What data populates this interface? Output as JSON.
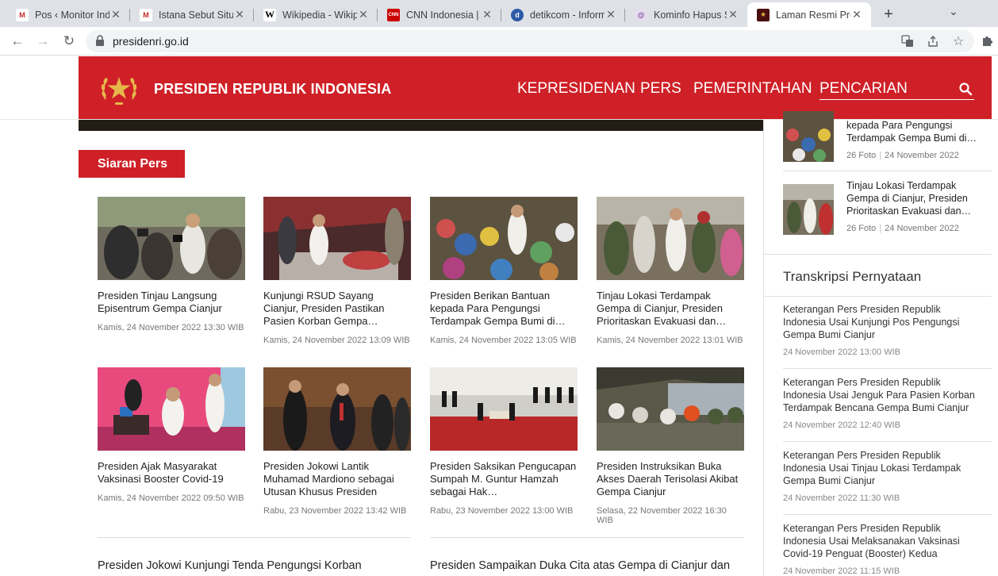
{
  "browser": {
    "tabs": [
      {
        "title": "Pos ‹ Monitor Ind",
        "favicon": "monitor-m-icon",
        "favicon_text": "M",
        "favicon_color": "#c62828"
      },
      {
        "title": "Istana Sebut Situs",
        "favicon": "monitor-m-icon",
        "favicon_text": "M",
        "favicon_color": "#c62828"
      },
      {
        "title": "Wikipedia - Wikip",
        "favicon": "wikipedia-w-icon",
        "favicon_text": "W",
        "favicon_color": "#000000"
      },
      {
        "title": "CNN Indonesia |",
        "favicon": "cnn-icon",
        "favicon_text": "CNN",
        "favicon_color": "#cc0000"
      },
      {
        "title": "detikcom - Inform",
        "favicon": "detik-icon",
        "favicon_text": "d",
        "favicon_color": "#2b5aa8"
      },
      {
        "title": "Kominfo Hapus S",
        "favicon": "kominfo-icon",
        "favicon_text": "@",
        "favicon_color": "#7b4fa0"
      },
      {
        "title": "Laman Resmi Pre",
        "favicon": "garuda-icon",
        "favicon_text": "★",
        "favicon_color": "#7a1c1c"
      }
    ],
    "url": "presidenri.go.id"
  },
  "site": {
    "name": "PRESIDEN REPUBLIK INDONESIA",
    "menu": [
      "KEPRESIDENAN",
      "PERS",
      "PEMERINTAHAN"
    ],
    "search_label": "PENCARIAN",
    "brand_color": "#cf2027"
  },
  "section": {
    "title": "Siaran Pers"
  },
  "cards": [
    {
      "title": "Presiden Tinjau Langsung Episentrum Gempa Cianjur",
      "date": "Kamis, 24 November 2022 13:30 WIB"
    },
    {
      "title": "Kunjungi RSUD Sayang Cianjur, Presiden Pastikan Pasien Korban Gempa…",
      "date": "Kamis, 24 November 2022 13:09 WIB"
    },
    {
      "title": "Presiden Berikan Bantuan kepada Para Pengungsi Terdampak Gempa Bumi di…",
      "date": "Kamis, 24 November 2022 13:05 WIB"
    },
    {
      "title": "Tinjau Lokasi Terdampak Gempa di Cianjur, Presiden Prioritaskan Evakuasi dan…",
      "date": "Kamis, 24 November 2022 13:01 WIB"
    },
    {
      "title": "Presiden Ajak Masyarakat Vaksinasi Booster Covid-19",
      "date": "Kamis, 24 November 2022 09:50 WIB"
    },
    {
      "title": "Presiden Jokowi Lantik Muhamad Mardiono sebagai Utusan Khusus Presiden",
      "date": "Rabu, 23 November 2022 13:42 WIB"
    },
    {
      "title": "Presiden Saksikan Pengucapan Sumpah M. Guntur Hamzah sebagai Hak…",
      "date": "Rabu, 23 November 2022 13:00 WIB"
    },
    {
      "title": "Presiden Instruksikan Buka Akses Daerah Terisolasi Akibat Gempa Cianjur",
      "date": "Selasa, 22 November 2022 16:30 WIB"
    }
  ],
  "bottom_titles": [
    "Presiden Jokowi Kunjungi Tenda Pengungsi Korban",
    "Presiden Sampaikan Duka Cita atas Gempa di Cianjur dan"
  ],
  "gallery": [
    {
      "title": "kepada Para Pengungsi Terdampak Gempa Bumi di…",
      "count": "26 Foto",
      "date": "24 November 2022"
    },
    {
      "title": "Tinjau Lokasi Terdampak Gempa di Cianjur, Presiden Prioritaskan Evakuasi dan…",
      "count": "26 Foto",
      "date": "24 November 2022"
    }
  ],
  "transcripts": {
    "heading": "Transkripsi Pernyataan",
    "items": [
      {
        "title": "Keterangan Pers Presiden Republik Indonesia Usai Kunjungi Pos Pengungsi Gempa Bumi Cianjur",
        "date": "24 November 2022 13:00 WIB"
      },
      {
        "title": "Keterangan Pers Presiden Republik Indonesia Usai Jenguk Para Pasien Korban Terdampak Bencana Gempa Bumi Cianjur",
        "date": "24 November 2022 12:40 WIB"
      },
      {
        "title": "Keterangan Pers Presiden Republik Indonesia Usai Tinjau Lokasi Terdampak Gempa Bumi Cianjur",
        "date": "24 November 2022 11:30 WIB"
      },
      {
        "title": "Keterangan Pers Presiden Republik Indonesia Usai Melaksanakan Vaksinasi Covid-19 Penguat (Booster) Kedua",
        "date": "24 November 2022 11:15 WIB"
      }
    ]
  }
}
